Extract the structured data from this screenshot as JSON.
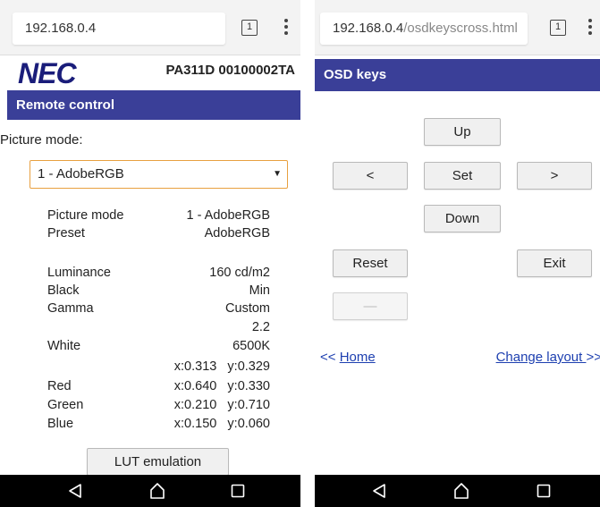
{
  "left": {
    "browser": {
      "url": "192.168.0.4",
      "tab_count": "1"
    },
    "brand": {
      "logo": "NEC",
      "model": "PA311D 00100002TA"
    },
    "header": "Remote control",
    "picture_mode_label": "Picture mode:",
    "picture_mode_select": "1 - AdobeRGB",
    "info": [
      {
        "k": "Picture mode",
        "v": "1 - AdobeRGB"
      },
      {
        "k": "Preset",
        "v": "AdobeRGB"
      },
      {
        "k": "Luminance",
        "v": "160 cd/m2"
      },
      {
        "k": "Black",
        "v": "Min"
      },
      {
        "k": "Gamma",
        "v": "Custom"
      },
      {
        "k": "",
        "v": "2.2"
      },
      {
        "k": "White",
        "v": "6500K"
      },
      {
        "k": "",
        "v": "x:0.313   y:0.329"
      },
      {
        "k": "Red",
        "v": "x:0.640   y:0.330"
      },
      {
        "k": "Green",
        "v": "x:0.210   y:0.710"
      },
      {
        "k": "Blue",
        "v": "x:0.150   y:0.060"
      }
    ],
    "lut_button": "LUT emulation"
  },
  "right": {
    "browser": {
      "url_host": "192.168.0.4",
      "url_path": "/osdkeyscross.html",
      "tab_count": "1"
    },
    "header": "OSD keys",
    "buttons": {
      "up": "Up",
      "left": "<",
      "set": "Set",
      "right": ">",
      "down": "Down",
      "reset": "Reset",
      "exit": "Exit",
      "blank": "—"
    },
    "links": {
      "home_prefix": "<< ",
      "home": "Home",
      "change_layout": "Change layout ",
      "change_layout_suffix": ">>"
    }
  },
  "colors": {
    "header_bg": "#3a3f98",
    "nec_blue": "#1a1d7a",
    "link": "#1d3fb0",
    "select_border": "#e8a040"
  },
  "icons": [
    "back-icon",
    "home-icon",
    "recents-icon",
    "tabs-icon",
    "menu-icon"
  ]
}
